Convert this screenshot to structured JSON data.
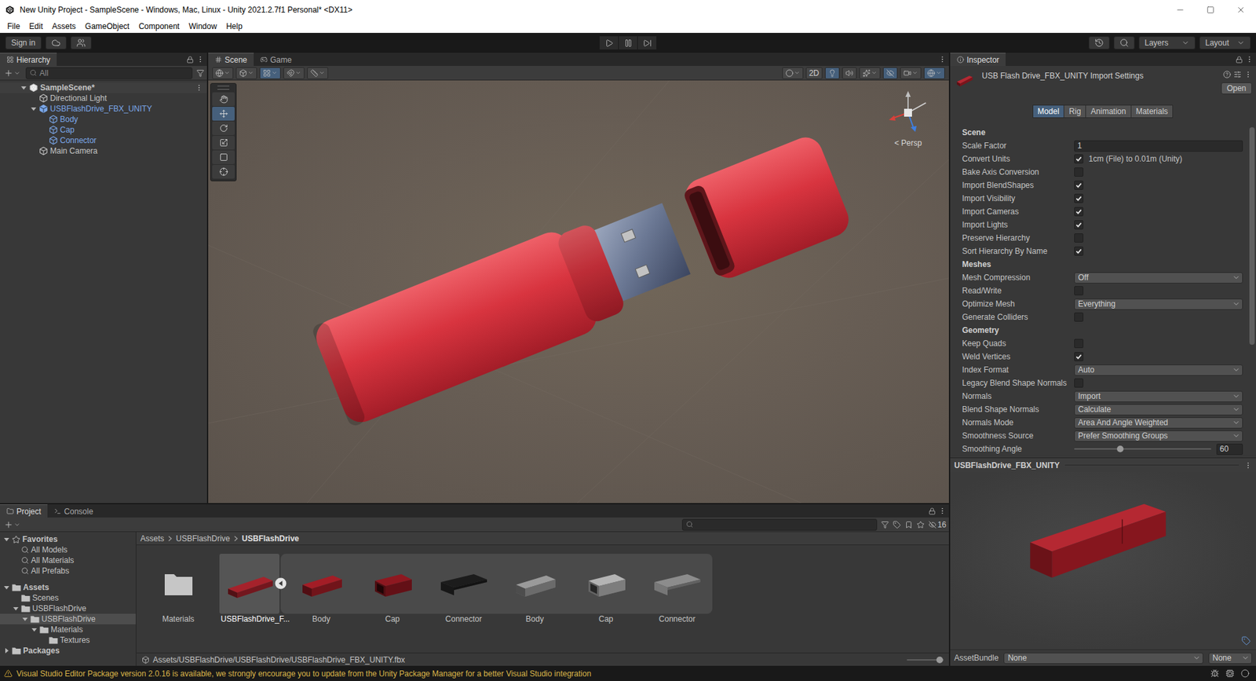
{
  "window": {
    "title": "New Unity Project - SampleScene - Windows, Mac, Linux - Unity 2021.2.7f1 Personal* <DX11>"
  },
  "menu": [
    "File",
    "Edit",
    "Assets",
    "GameObject",
    "Component",
    "Window",
    "Help"
  ],
  "toolbar": {
    "account": "Sign in",
    "layers": "Layers",
    "layout": "Layout"
  },
  "hierarchy": {
    "tab": "Hierarchy",
    "search": "All",
    "items": [
      {
        "label": "SampleScene*",
        "kind": "scene",
        "expanded": true,
        "selected": false,
        "children": [
          {
            "label": "Directional Light",
            "kind": "object",
            "selected": false
          },
          {
            "label": "USBFlashDrive_FBX_UNITY",
            "kind": "prefab",
            "expanded": true,
            "selected": false,
            "children": [
              {
                "label": "Body",
                "kind": "prefab-part",
                "selected": false
              },
              {
                "label": "Cap",
                "kind": "prefab-part",
                "selected": false
              },
              {
                "label": "Connector",
                "kind": "prefab-part",
                "selected": false
              }
            ]
          },
          {
            "label": "Main Camera",
            "kind": "object",
            "selected": false
          }
        ]
      }
    ]
  },
  "scene": {
    "tabs": [
      {
        "label": "Scene",
        "kind": "scene",
        "selected": true
      },
      {
        "label": "Game",
        "kind": "game",
        "selected": false
      }
    ],
    "view_tools": [
      {
        "kind": "global",
        "on": false
      },
      {
        "kind": "pivot",
        "on": false
      },
      {
        "kind": "grid",
        "on": true
      },
      {
        "kind": "snap",
        "on": false
      },
      {
        "kind": "increment",
        "on": false
      }
    ],
    "display_tools": [
      {
        "kind": "shading",
        "on": false
      },
      {
        "kind": "2d",
        "label": "2D",
        "on": false
      },
      {
        "kind": "lighting",
        "on": true
      },
      {
        "kind": "audio",
        "on": false
      },
      {
        "kind": "effects",
        "on": false
      },
      {
        "kind": "visibility",
        "on": true
      },
      {
        "kind": "camera",
        "on": false
      },
      {
        "kind": "gizmos",
        "on": true
      }
    ],
    "tools": [
      {
        "kind": "hand",
        "selected": false
      },
      {
        "kind": "move",
        "selected": true
      },
      {
        "kind": "rotate",
        "selected": false
      },
      {
        "kind": "scale",
        "selected": false
      },
      {
        "kind": "rect",
        "selected": false
      },
      {
        "kind": "transform",
        "selected": false
      }
    ],
    "projection": "< Persp"
  },
  "inspector": {
    "tab": "Inspector",
    "title": "USB Flash Drive_FBX_UNITY Import Settings",
    "open": "Open",
    "tabs": [
      {
        "label": "Model",
        "selected": true
      },
      {
        "label": "Rig",
        "selected": false
      },
      {
        "label": "Animation",
        "selected": false
      },
      {
        "label": "Materials",
        "selected": false
      }
    ],
    "sections": [
      {
        "title": "Scene",
        "rows": [
          {
            "label": "Scale Factor",
            "kind": "text",
            "value": "1"
          },
          {
            "label": "Convert Units",
            "kind": "checkbox",
            "checked": true,
            "note": "1cm (File) to 0.01m (Unity)"
          },
          {
            "label": "Bake Axis Conversion",
            "kind": "checkbox",
            "checked": false
          },
          {
            "label": "Import BlendShapes",
            "kind": "checkbox",
            "checked": true
          },
          {
            "label": "Import Visibility",
            "kind": "checkbox",
            "checked": true
          },
          {
            "label": "Import Cameras",
            "kind": "checkbox",
            "checked": true
          },
          {
            "label": "Import Lights",
            "kind": "checkbox",
            "checked": true
          },
          {
            "label": "Preserve Hierarchy",
            "kind": "checkbox",
            "checked": false
          },
          {
            "label": "Sort Hierarchy By Name",
            "kind": "checkbox",
            "checked": true
          }
        ]
      },
      {
        "title": "Meshes",
        "rows": [
          {
            "label": "Mesh Compression",
            "kind": "dropdown",
            "value": "Off"
          },
          {
            "label": "Read/Write",
            "kind": "checkbox",
            "checked": false
          },
          {
            "label": "Optimize Mesh",
            "kind": "dropdown",
            "value": "Everything"
          },
          {
            "label": "Generate Colliders",
            "kind": "checkbox",
            "checked": false
          }
        ]
      },
      {
        "title": "Geometry",
        "rows": [
          {
            "label": "Keep Quads",
            "kind": "checkbox",
            "checked": false
          },
          {
            "label": "Weld Vertices",
            "kind": "checkbox",
            "checked": true
          },
          {
            "label": "Index Format",
            "kind": "dropdown",
            "value": "Auto"
          },
          {
            "label": "Legacy Blend Shape Normals",
            "kind": "checkbox",
            "checked": false
          },
          {
            "label": "Normals",
            "kind": "dropdown",
            "value": "Import"
          },
          {
            "label": "Blend Shape Normals",
            "kind": "dropdown",
            "value": "Calculate"
          },
          {
            "label": "Normals Mode",
            "kind": "dropdown",
            "value": "Area And Angle Weighted"
          },
          {
            "label": "Smoothness Source",
            "kind": "dropdown",
            "value": "Prefer Smoothing Groups"
          },
          {
            "label": "Smoothing Angle",
            "kind": "slider",
            "level": 0.335,
            "value": "60"
          }
        ]
      }
    ],
    "preview_title": "USBFlashDrive_FBX_UNITY",
    "asset_bundle": {
      "label": "AssetBundle",
      "name": "None",
      "variant": "None"
    }
  },
  "project": {
    "tabs": [
      {
        "label": "Project",
        "kind": "project",
        "selected": true
      },
      {
        "label": "Console",
        "kind": "console",
        "selected": false
      }
    ],
    "hidden_count": "16",
    "tree": [
      {
        "label": "Favorites",
        "kind": "favorites",
        "expanded": true,
        "selected": false,
        "children": [
          {
            "label": "All Models",
            "kind": "search",
            "selected": false
          },
          {
            "label": "All Materials",
            "kind": "search",
            "selected": false
          },
          {
            "label": "All Prefabs",
            "kind": "search",
            "selected": false
          }
        ]
      },
      {
        "label": "Assets",
        "kind": "root",
        "expanded": true,
        "selected": false,
        "children": [
          {
            "label": "Scenes",
            "kind": "folder",
            "selected": false
          },
          {
            "label": "USBFlashDrive",
            "kind": "folder",
            "expanded": true,
            "selected": false,
            "children": [
              {
                "label": "USBFlashDrive",
                "kind": "folder",
                "expanded": true,
                "selected": true,
                "children": [
                  {
                    "label": "Materials",
                    "kind": "folder",
                    "expanded": true,
                    "selected": false,
                    "children": [
                      {
                        "label": "Textures",
                        "kind": "folder",
                        "selected": false
                      }
                    ]
                  }
                ]
              }
            ]
          }
        ]
      },
      {
        "label": "Packages",
        "kind": "root",
        "expanded": false,
        "selected": false
      }
    ],
    "breadcrumbs": [
      {
        "label": "Assets",
        "selected": false
      },
      {
        "label": "USBFlashDrive",
        "selected": false
      },
      {
        "label": "USBFlashDrive",
        "selected": true
      }
    ],
    "assets": [
      {
        "label": "Materials",
        "kind": "folder",
        "selected": false
      },
      {
        "label": "USBFlashDrive_F...",
        "kind": "model",
        "selected": true,
        "expanded": true,
        "children": [
          {
            "label": "Body",
            "kind": "body",
            "color": "#a31d26",
            "selected": false
          },
          {
            "label": "Cap",
            "kind": "cap",
            "color": "#8e1820",
            "selected": false
          },
          {
            "label": "Connector",
            "kind": "connector",
            "color": "#1c1c1c",
            "selected": false
          },
          {
            "label": "Body",
            "kind": "body",
            "color": "#9a9a9a",
            "selected": false
          },
          {
            "label": "Cap",
            "kind": "cap",
            "color": "#b4b4b4",
            "selected": false
          },
          {
            "label": "Connector",
            "kind": "connector",
            "color": "#8c8c8c",
            "selected": false
          }
        ]
      }
    ],
    "path": "Assets/USBFlashDrive/USBFlashDrive/USBFlashDrive_FBX_UNITY.fbx",
    "zoom_level": 0.9
  },
  "status_bar": {
    "message": "Visual Studio Editor Package version 2.0.16 is available, we strongly encourage you to update from the Unity Package Manager for a better Visual Studio integration"
  }
}
